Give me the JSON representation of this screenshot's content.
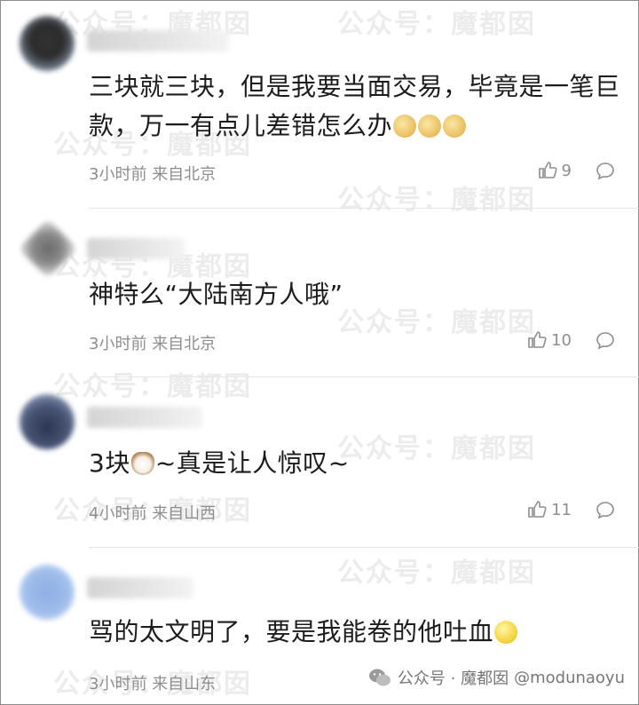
{
  "comments": [
    {
      "text": "三块就三块，但是我要当面交易，毕竟是一笔巨款，万一有点儿差错怎么办",
      "emoji": [
        "doge-emoji",
        "doge-emoji",
        "doge-emoji"
      ],
      "time": "3小时前",
      "location": "来自北京",
      "likes": "9"
    },
    {
      "text": "神特么“大陆南方人哦”",
      "emoji": [],
      "time": "3小时前",
      "location": "来自北京",
      "likes": "10"
    },
    {
      "text_before": "3块",
      "text_after": "~真是让人惊叹~",
      "emoji": [
        "cat-emoji"
      ],
      "time": "4小时前",
      "location": "来自山西",
      "likes": "11"
    },
    {
      "text": "骂的太文明了，要是我能卷的他吐血",
      "emoji": [
        "smile-emoji"
      ],
      "time": "3小时前",
      "location": "来自山东",
      "likes": ""
    }
  ],
  "watermark": {
    "account": "公众号：魔都囡",
    "footer": "公众号 · 魔都囡",
    "footer_handle": "@modunaoyu"
  },
  "colors": {
    "text": "#1c1c1c",
    "meta": "#8e8e8e",
    "divider": "#e6e6e6"
  }
}
